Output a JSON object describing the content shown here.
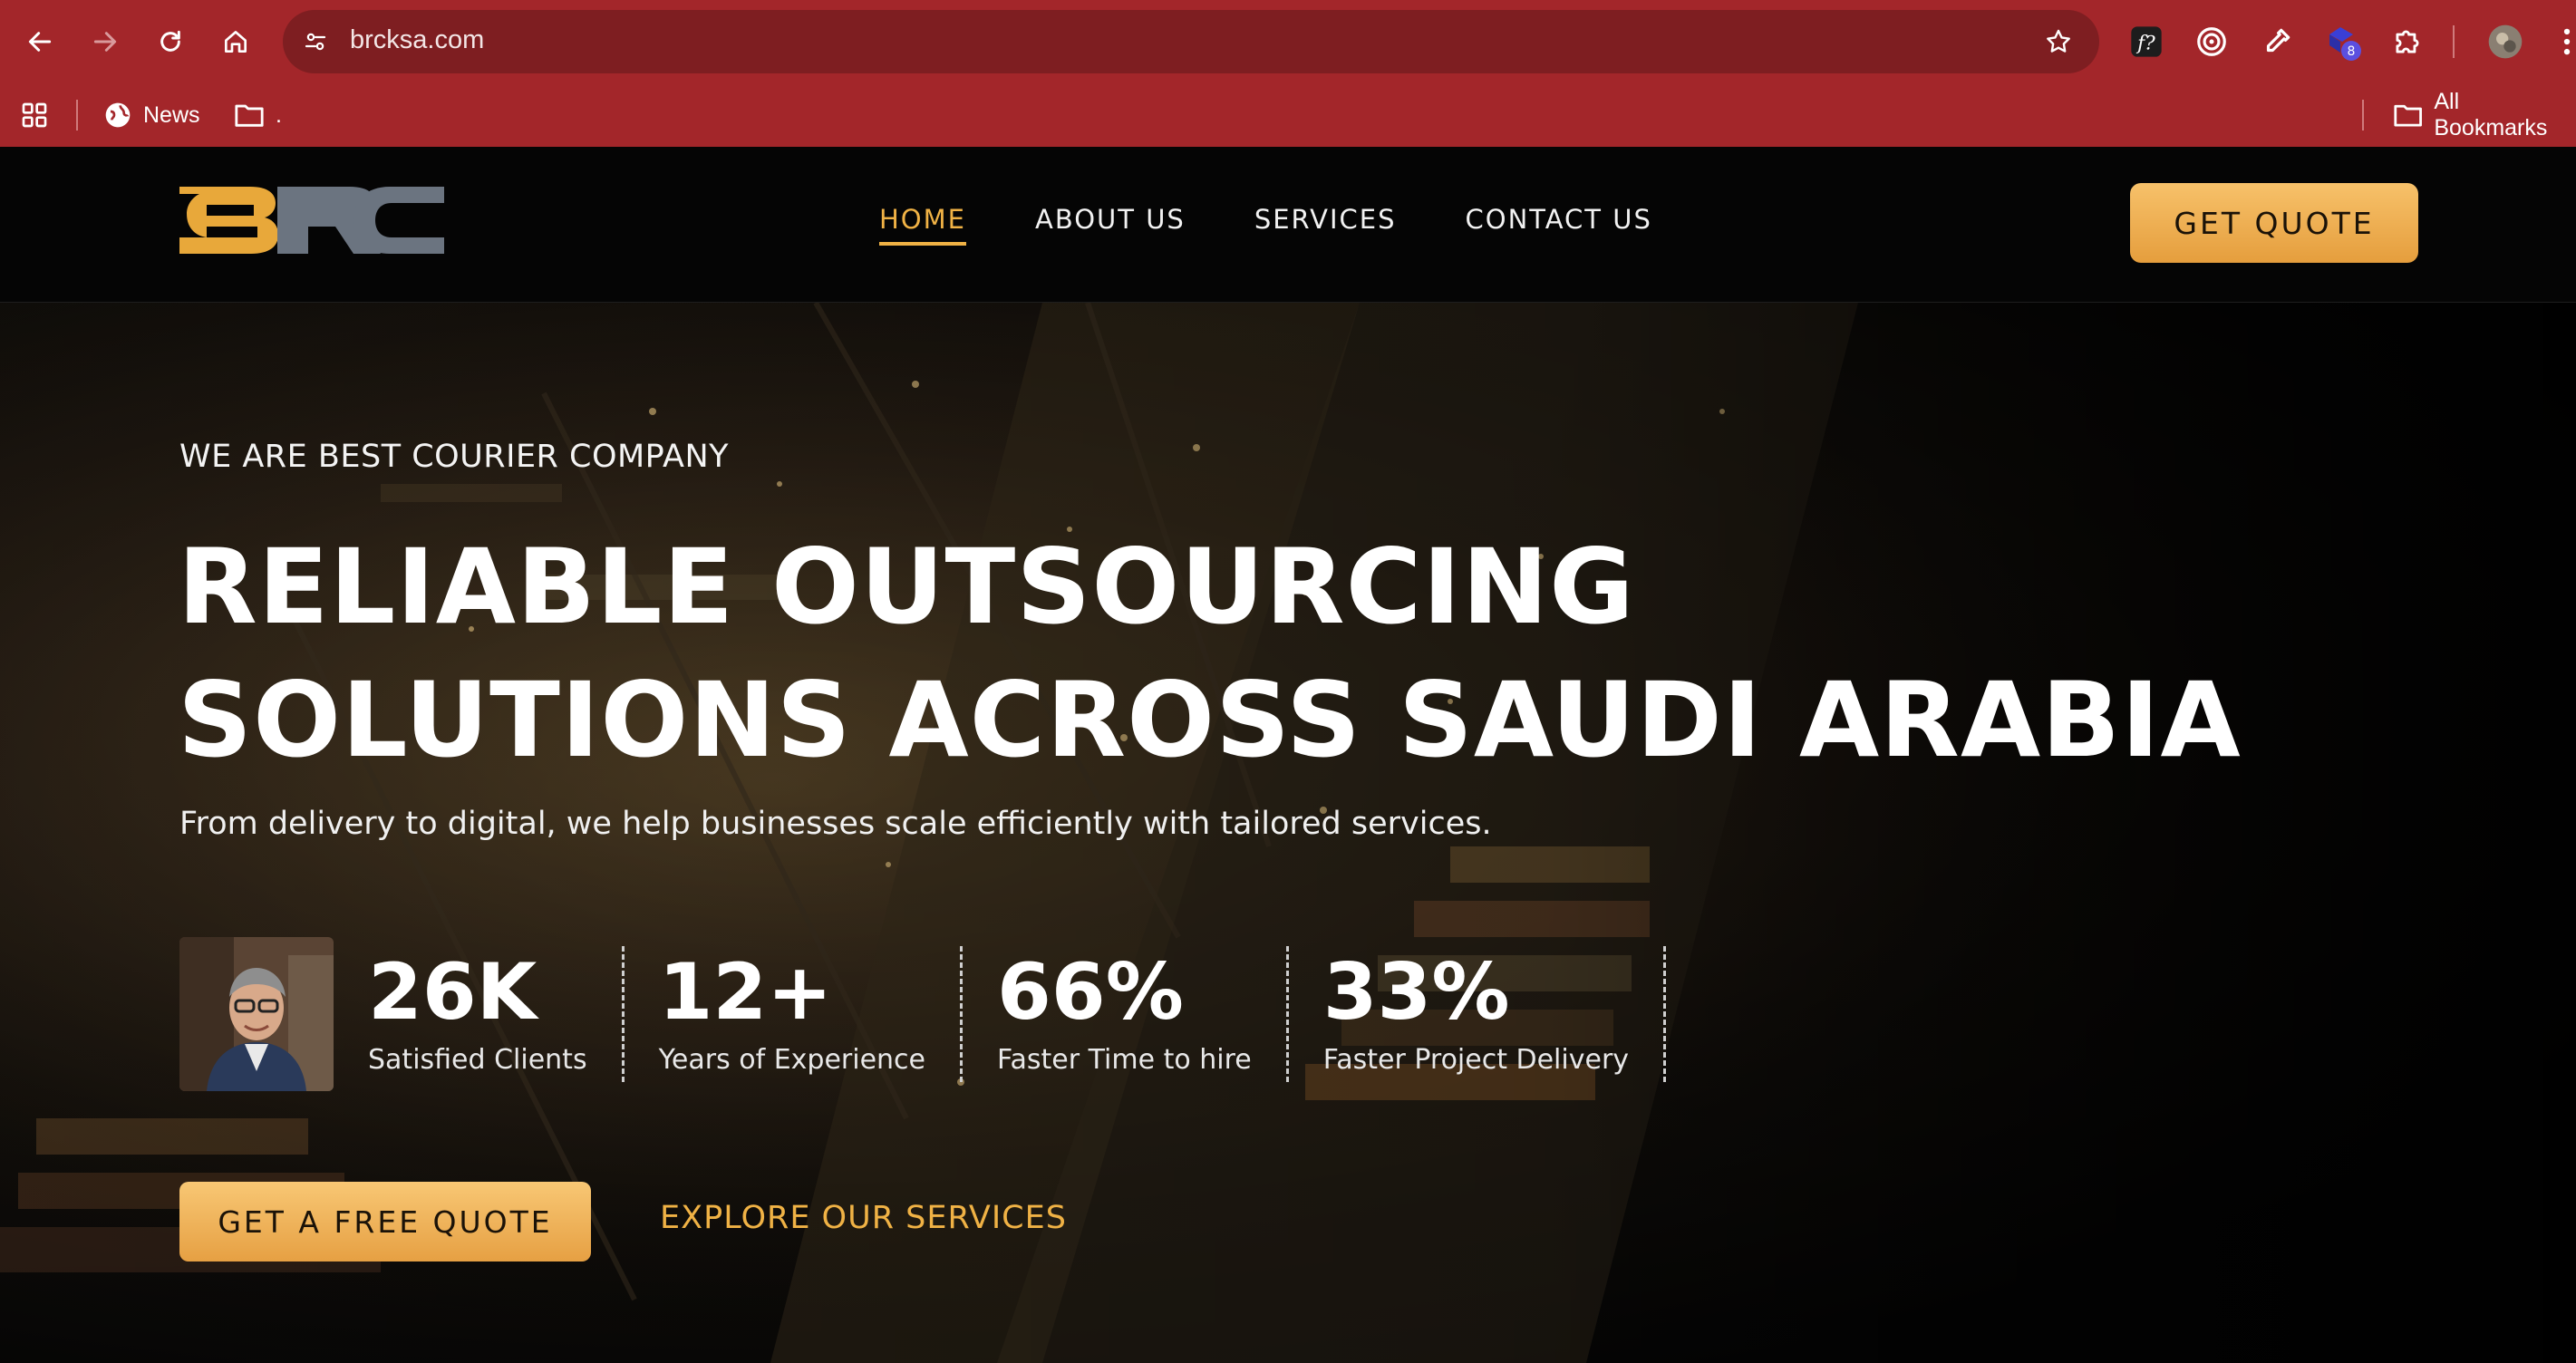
{
  "browser": {
    "url": "brcksa.com",
    "bookmarks": [
      {
        "label": "News"
      },
      {
        "label": "."
      }
    ],
    "all_bookmarks_label": "All Bookmarks",
    "extension_badge": "8"
  },
  "header": {
    "logo_text": "BRC",
    "nav": [
      {
        "label": "HOME",
        "active": true
      },
      {
        "label": "ABOUT US",
        "active": false
      },
      {
        "label": "SERVICES",
        "active": false
      },
      {
        "label": "CONTACT US",
        "active": false
      }
    ],
    "quote_button": "GET QUOTE"
  },
  "hero": {
    "eyebrow": "WE ARE BEST COURIER COMPANY",
    "headline_line1": "RELIABLE OUTSOURCING",
    "headline_line2": "SOLUTIONS ACROSS SAUDI ARABIA",
    "subline": "From delivery to digital, we help businesses scale efficiently with tailored services.",
    "stats": [
      {
        "value": "26K",
        "label": "Satisfied Clients"
      },
      {
        "value": "12+",
        "label": "Years of Experience"
      },
      {
        "value": "66%",
        "label": "Faster Time to hire"
      },
      {
        "value": "33%",
        "label": "Faster Project Delivery"
      }
    ],
    "cta_primary": "GET A FREE QUOTE",
    "cta_secondary": "EXPLORE OUR SERVICES"
  },
  "colors": {
    "browser_frame": "#a3262a",
    "accent": "#f0b245",
    "button_gradient_top": "#f7c16a",
    "button_gradient_bottom": "#e59e3d"
  }
}
